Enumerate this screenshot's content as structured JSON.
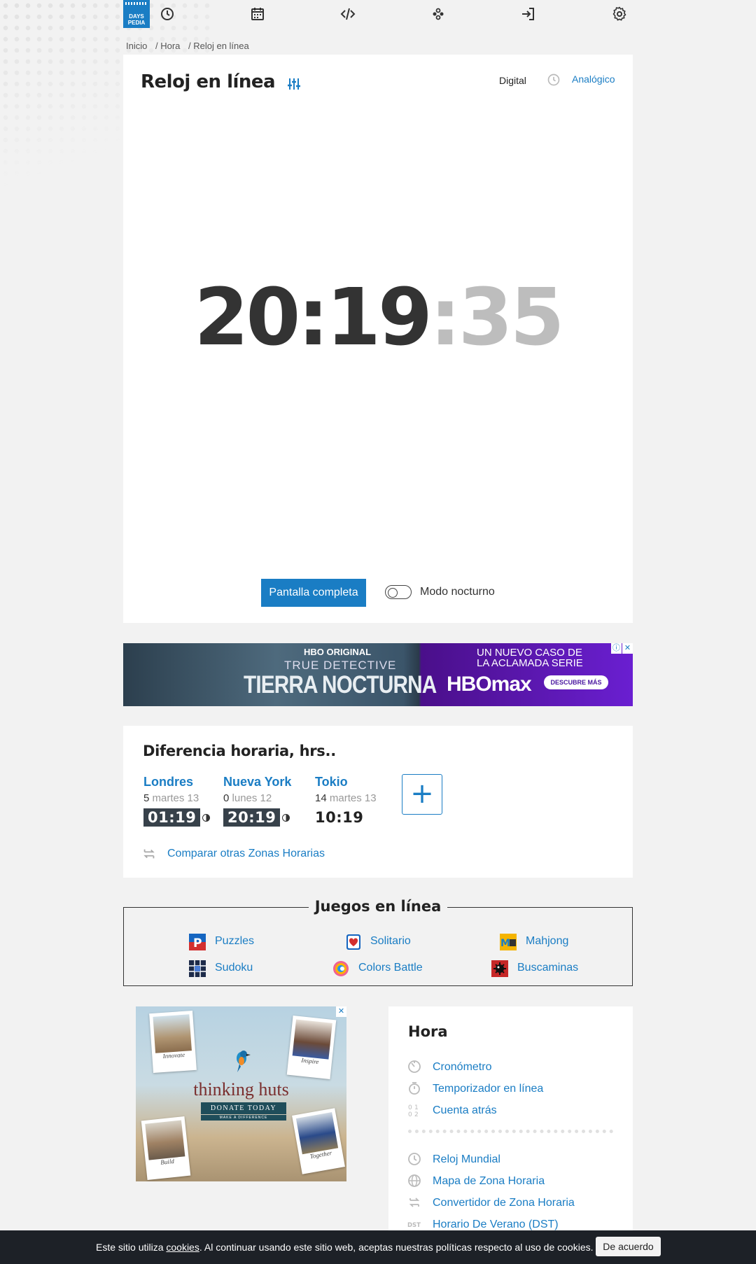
{
  "nav": {
    "logo_line1": "DAYS",
    "logo_line2": "PEDIA",
    "icons": [
      "clock-icon",
      "calendar-icon",
      "code-icon",
      "games-icon",
      "login-icon",
      "gear-icon"
    ]
  },
  "breadcrumb": [
    "Inicio",
    "/  Hora",
    "/  Reloj en línea"
  ],
  "clock": {
    "title": "Reloj en línea",
    "mode_digital": "Digital",
    "mode_analog": "Analógico",
    "hours_minutes": "20:19",
    "seconds": ":35",
    "fullscreen_label": "Pantalla completa",
    "night_mode_label": "Modo nocturno",
    "night_mode_on": false
  },
  "ad_banner": {
    "hbo_original": "HBO ORIGINAL",
    "show_line1": "TRUE DETECTIVE",
    "show_line2": "TIERRA NOCTURNA",
    "serie_line1": "UN NUEVO CASO DE",
    "serie_line2": "LA ACLAMADA SERIE",
    "brand": "HBOmax",
    "cta": "DESCUBRE MÁS"
  },
  "time_difference": {
    "title": "Diferencia horaria, hrs..",
    "cities": [
      {
        "name": "Londres",
        "offset": "5",
        "day": "martes 13",
        "time": "01:19",
        "night": true
      },
      {
        "name": "Nueva York",
        "offset": "0",
        "day": "lunes 12",
        "time": "20:19",
        "night": true
      },
      {
        "name": "Tokio",
        "offset": "14",
        "day": "martes 13",
        "time": "10:19",
        "night": false
      }
    ],
    "add_label": "+",
    "compare_link": "Comparar otras Zonas Horarias"
  },
  "games": {
    "title": "Juegos en línea",
    "items": [
      "Puzzles",
      "Solitario",
      "Mahjong",
      "Sudoku",
      "Colors Battle",
      "Buscaminas"
    ]
  },
  "ad_side": {
    "caption1": "Innovate",
    "caption2": "Inspire",
    "caption3": "Build",
    "caption4": "Together",
    "brand": "thinking huts",
    "cta": "DONATE TODAY",
    "tagline": "MAKE A DIFFERENCE"
  },
  "sidebar": {
    "title": "Hora",
    "group1": [
      "Cronómetro",
      "Temporizador en línea",
      "Cuenta atrás"
    ],
    "group2": [
      "Reloj Mundial",
      "Mapa de Zona Horaria",
      "Convertidor de Zona Horaria",
      "Horario De Verano (DST)"
    ]
  },
  "cookie": {
    "text_before": "Este sitio utiliza ",
    "link": "cookies",
    "text_after": ". Al continuar usando este sitio web, aceptas nuestras políticas respecto al uso de cookies.",
    "button": "De acuerdo"
  },
  "colors": {
    "accent": "#1a7dc4",
    "dark": "#37414a",
    "seconds": "#bdbdbd"
  }
}
